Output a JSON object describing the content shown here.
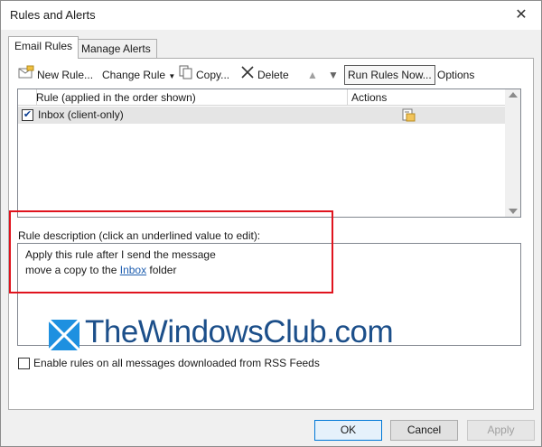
{
  "window": {
    "title": "Rules and Alerts"
  },
  "tabs": [
    {
      "label": "Email Rules",
      "active": true
    },
    {
      "label": "Manage Alerts",
      "active": false
    }
  ],
  "toolbar": {
    "new_rule": "New Rule...",
    "change_rule": "Change Rule",
    "copy": "Copy...",
    "delete": "Delete",
    "run_rules_now": "Run Rules Now...",
    "options": "Options"
  },
  "rules_list": {
    "columns": {
      "rule": "Rule (applied in the order shown)",
      "actions": "Actions"
    },
    "rows": [
      {
        "name": "Inbox  (client-only)",
        "checked": true,
        "action_icon": "move-to-folder-icon"
      }
    ]
  },
  "description": {
    "label": "Rule description (click an underlined value to edit):",
    "line1": "Apply this rule after I send the message",
    "line2_prefix": "move a copy to the ",
    "line2_link": "Inbox",
    "line2_suffix": " folder"
  },
  "watermark": {
    "text": "TheWindowsClub.com"
  },
  "rss_option": {
    "label": "Enable rules on all messages downloaded from RSS Feeds",
    "checked": false
  },
  "buttons": {
    "ok": "OK",
    "cancel": "Cancel",
    "apply": "Apply"
  },
  "colors": {
    "highlight": "#e0141e",
    "link": "#1f5fb0",
    "watermark": "#1c4f8a"
  }
}
